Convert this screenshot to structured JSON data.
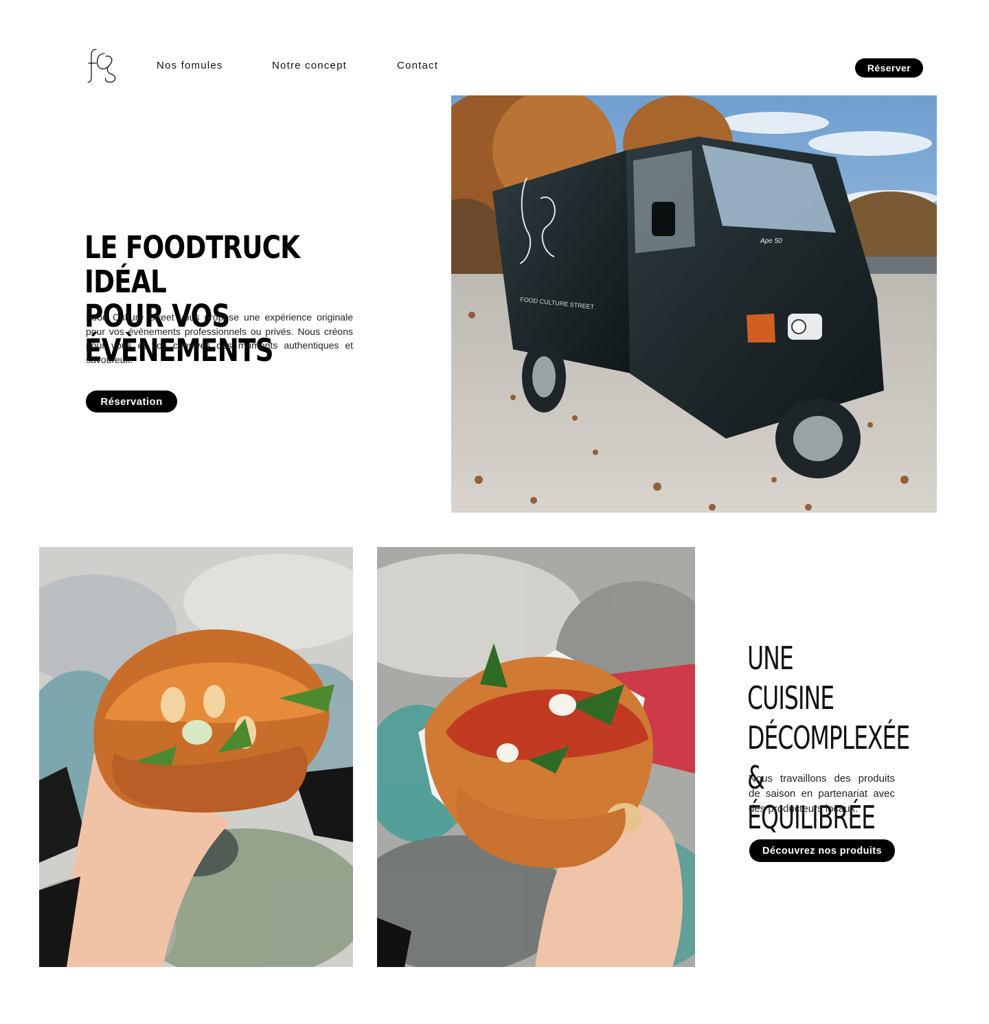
{
  "nav": {
    "links": [
      "Nos fomules",
      "Notre concept",
      "Contact"
    ],
    "cta_label": "Réserver"
  },
  "hero": {
    "title_line1": "LE FOODTRUCK IDÉAL",
    "title_line2": "POUR VOS ÉVÈNEMENTS",
    "text": "Food Culture Street vous propose une expérience originale pour vos évènements professionnels ou privés. Nous créons pour vous et vos convives des moments authentiques et savoureux.",
    "button_label": "Réservation",
    "truck_lettering": "FOOD CULTURE STREET",
    "truck_badge": "Ape 50"
  },
  "cuisine": {
    "title_line1": "UNE CUISINE",
    "title_line2": "DÉCOMPLEXÉE",
    "title_line3": "& ÉQUILIBRÉE",
    "text": "Nous travaillons des produits de saison en partenariat avec des producteurs locaux.",
    "button_label": "Découvrez nos produits"
  },
  "colors": {
    "accent": "#000000",
    "background": "#ffffff",
    "button_text": "#ffffff"
  },
  "icons": {
    "logo": "fcs-monogram-logo"
  }
}
